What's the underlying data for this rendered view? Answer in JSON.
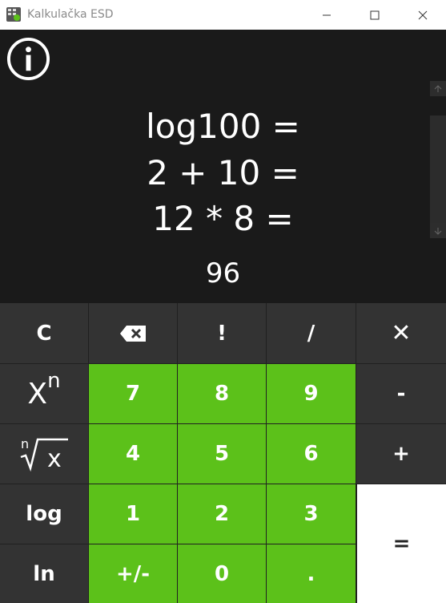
{
  "window": {
    "title": "Kalkulačka ESD"
  },
  "display": {
    "history": [
      "log100 =",
      "2 + 10 =",
      "12 * 8 ="
    ],
    "result": "96"
  },
  "keys": {
    "clear": "C",
    "factorial": "!",
    "divide": "/",
    "multiply": "✕",
    "power_base": "X",
    "power_exp": "n",
    "seven": "7",
    "eight": "8",
    "nine": "9",
    "minus": "-",
    "root_index": "n",
    "root_radicand": "x",
    "four": "4",
    "five": "5",
    "six": "6",
    "plus": "+",
    "log": "log",
    "one": "1",
    "two": "2",
    "three": "3",
    "equals": "=",
    "ln": "ln",
    "negate": "+/-",
    "zero": "0",
    "decimal": "."
  },
  "icons": {
    "app": "calculator-icon",
    "info": "info-icon",
    "backspace": "backspace-icon"
  },
  "colors": {
    "digit_key": "#5cc11a",
    "operator_key": "#333333",
    "equals_key": "#ffffff",
    "display_bg": "#1a1a1a"
  }
}
